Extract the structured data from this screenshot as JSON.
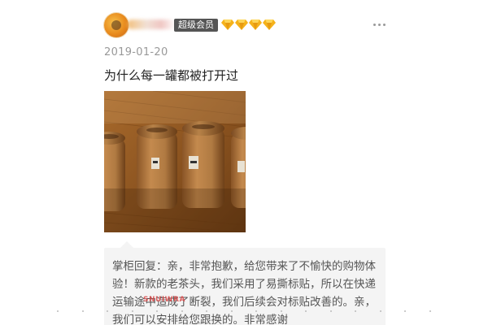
{
  "user": {
    "badge": "超级会员",
    "diamond_count": 4,
    "diamond_color": "#f5b21a"
  },
  "review": {
    "date": "2019-01-20",
    "text": "为什么每一罐都被打开过",
    "photo_icon": "tea-canisters-photo"
  },
  "reply": {
    "text": "掌柜回复：亲，非常抱歉，给您带来了不愉快的购物体验！新款的老茶头，我们采用了易撕标贴，所以在快递运输途中造成了断裂，我们后续会对标贴改善的。亲，我们可以安排给您跟换的。非常感谢"
  },
  "watermark": {
    "text": "SNUIWRA"
  },
  "colors": {
    "badge_bg": "#555555",
    "reply_bg": "#f4f4f4",
    "date_color": "#999999"
  }
}
